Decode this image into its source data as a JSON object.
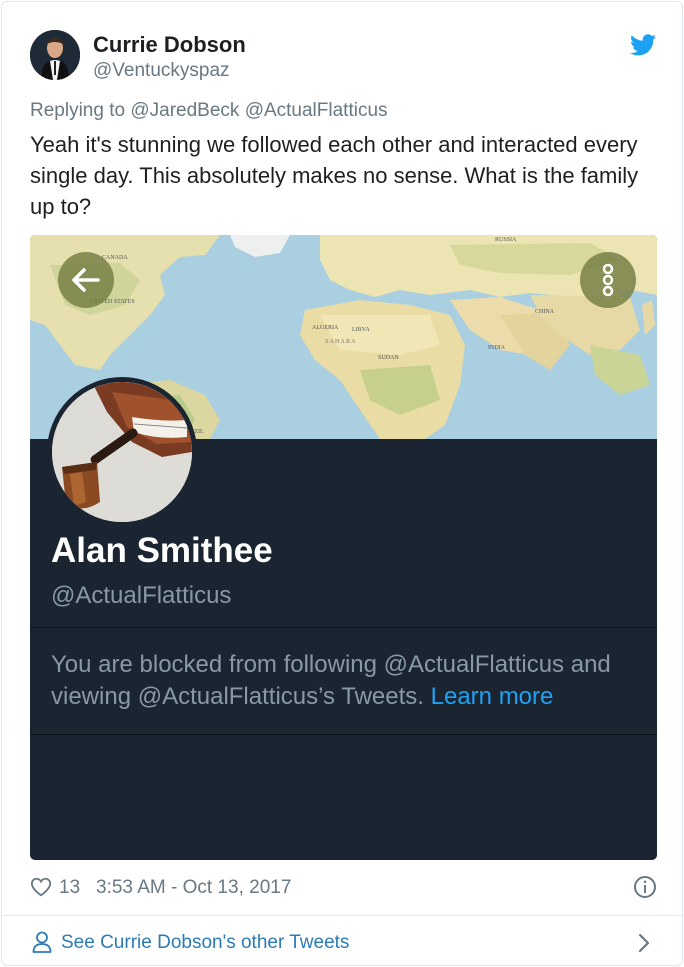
{
  "author": {
    "name": "Currie Dobson",
    "handle": "@Ventuckyspaz"
  },
  "reply": {
    "prefix": "Replying to",
    "mentions": [
      "@JaredBeck",
      "@ActualFlatticus"
    ]
  },
  "tweet": {
    "text": "Yeah it's stunning we followed each other and interacted every single day. This absolutely makes no sense. What is the family up to?"
  },
  "media": {
    "profile_name": "Alan Smithee",
    "profile_handle": "@ActualFlatticus",
    "blocked_message": "You are blocked from following @ActualFlatticus and viewing @ActualFlatticus’s Tweets.",
    "learn_more": "Learn more",
    "map_labels": {
      "russia": "RUSSIA",
      "canada": "CANADA",
      "united_states": "UNITED STATES",
      "algeria": "ALGERIA",
      "libya": "LIBYA",
      "sahara": "S A H A R A",
      "sudan": "SUDAN",
      "india": "INDIA",
      "china": "CHINA",
      "brazil": "BRAZIL"
    },
    "icons": [
      "back-arrow-icon",
      "more-vertical-icon"
    ]
  },
  "footer": {
    "like_count": "13",
    "timestamp": "3:53 AM - Oct 13, 2017"
  },
  "see_more": {
    "label": "See Currie Dobson's other Tweets"
  },
  "colors": {
    "twitter_blue": "#1da1f2",
    "link_blue": "#2b7bb9",
    "muted": "#697882",
    "card_dark": "#1b2532"
  }
}
